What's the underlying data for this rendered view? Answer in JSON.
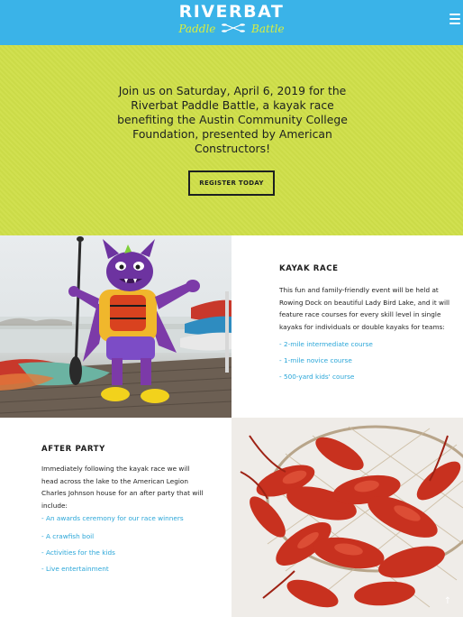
{
  "header": {
    "logo_main": "RIVERBAT",
    "logo_sub_left": "Paddle",
    "logo_sub_right": "Battle",
    "menu_icon": "hamburger-menu-icon",
    "colors": {
      "background": "#3ab3e8",
      "accent": "#d9ee3e"
    }
  },
  "hero": {
    "text": "Join us on Saturday, April 6, 2019 for the Riverbat Paddle Battle, a kayak race benefiting the Austin Community College Foundation, presented by American Constructors!",
    "register_label": "REGISTER TODAY",
    "background_color": "#cfdf49"
  },
  "kayak": {
    "title": "KAYAK RACE",
    "description": "This fun and family-friendly event will be held at Rowing Dock on beautiful Lady Bird Lake, and it will feature race courses for every skill level in single kayaks for individuals or double kayaks for teams:",
    "links": [
      "- 2-mile intermediate course",
      "- 1-mile novice course",
      "- 500-yard kids' course"
    ],
    "link_color": "#2aa6d8"
  },
  "party": {
    "title": "AFTER PARTY",
    "description": "Immediately following the kayak race we will head across the lake to the American Legion Charles Johnson house for an after party that will include:",
    "links": [
      "- An awards ceremony for our race winners",
      "- A crawfish boil",
      "- Activities for the kids",
      "- Live entertainment"
    ]
  },
  "scroll_top_icon": "arrow-up-icon"
}
